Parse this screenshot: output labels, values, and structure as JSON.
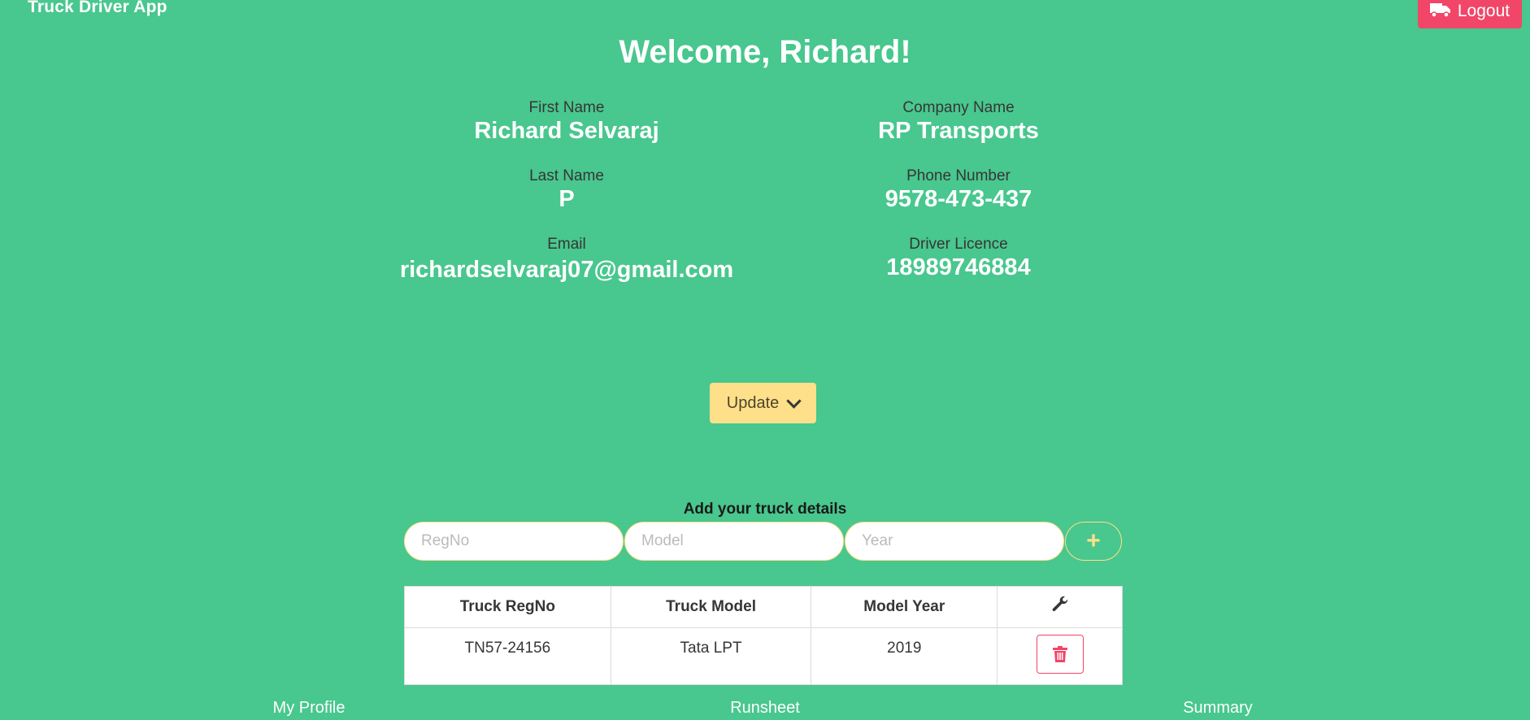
{
  "header": {
    "app_title": "Truck Driver App",
    "logout_label": "Logout"
  },
  "welcome": "Welcome, Richard!",
  "profile": {
    "first_name": {
      "label": "First Name",
      "value": "Richard Selvaraj"
    },
    "last_name": {
      "label": "Last Name",
      "value": "P"
    },
    "email": {
      "label": "Email",
      "value": "richardselvaraj07@gmail.com"
    },
    "company_name": {
      "label": "Company Name",
      "value": "RP Transports"
    },
    "phone_number": {
      "label": "Phone Number",
      "value": "9578-473-437"
    },
    "driver_licence": {
      "label": "Driver Licence",
      "value": "18989746884"
    }
  },
  "update_label": "Update",
  "truck_form": {
    "title": "Add your truck details",
    "regno_placeholder": "RegNo",
    "model_placeholder": "Model",
    "year_placeholder": "Year",
    "add_icon": "plus-icon"
  },
  "truck_table": {
    "headers": [
      "Truck RegNo",
      "Truck Model",
      "Model Year"
    ],
    "actions_icon": "wrench-icon",
    "rows": [
      {
        "regno": "TN57-24156",
        "model": "Tata LPT",
        "year": "2019",
        "action_icon": "trash-icon"
      }
    ]
  },
  "bottom_nav": {
    "profile": "My Profile",
    "runsheet": "Runsheet",
    "summary": "Summary"
  },
  "colors": {
    "background": "#48c78e",
    "danger": "#f14668",
    "warning": "#ffe08a"
  }
}
